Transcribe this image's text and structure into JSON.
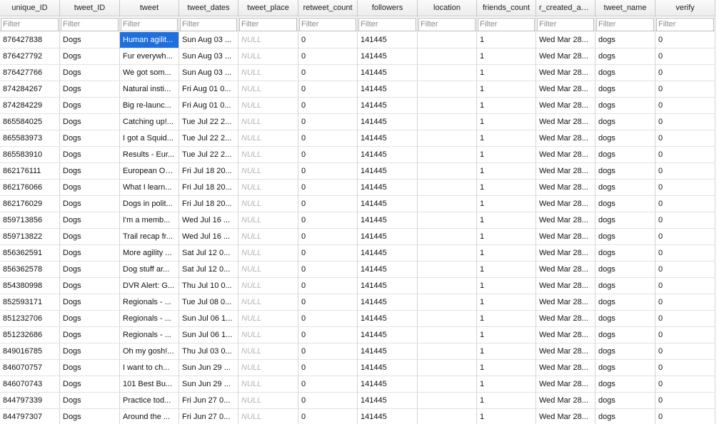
{
  "columns": [
    "unique_ID",
    "tweet_ID",
    "tweet",
    "tweet_dates",
    "tweet_place",
    "retweet_count",
    "followers",
    "location",
    "friends_count",
    "r_created_acco",
    "tweet_name",
    "verify"
  ],
  "filter_placeholder": "Filter",
  "null_text": "NULL",
  "selected": {
    "row": 0,
    "col": 2
  },
  "colors": {
    "selection": "#1f6fdc",
    "null_text": "#b3b3b3",
    "grid_line": "#d4d4d4"
  },
  "rows": [
    [
      "876427838",
      "Dogs",
      "Human agilit...",
      "Sun Aug 03 ...",
      "NULL",
      "0",
      "141445",
      "",
      "1",
      "Wed Mar 28...",
      "dogs",
      "0"
    ],
    [
      "876427792",
      "Dogs",
      "Fur everywh...",
      "Sun Aug 03 ...",
      "NULL",
      "0",
      "141445",
      "",
      "1",
      "Wed Mar 28...",
      "dogs",
      "0"
    ],
    [
      "876427766",
      "Dogs",
      "We got som...",
      "Sun Aug 03 ...",
      "NULL",
      "0",
      "141445",
      "",
      "1",
      "Wed Mar 28...",
      "dogs",
      "0"
    ],
    [
      "874284267",
      "Dogs",
      "Natural insti...",
      "Fri Aug 01 0...",
      "NULL",
      "0",
      "141445",
      "",
      "1",
      "Wed Mar 28...",
      "dogs",
      "0"
    ],
    [
      "874284229",
      "Dogs",
      "Big re-launc...",
      "Fri Aug 01 0...",
      "NULL",
      "0",
      "141445",
      "",
      "1",
      "Wed Mar 28...",
      "dogs",
      "0"
    ],
    [
      "865584025",
      "Dogs",
      "Catching up!...",
      "Tue Jul 22 2...",
      "NULL",
      "0",
      "141445",
      "",
      "1",
      "Wed Mar 28...",
      "dogs",
      "0"
    ],
    [
      "865583973",
      "Dogs",
      "I got a Squid...",
      "Tue Jul 22 2...",
      "NULL",
      "0",
      "141445",
      "",
      "1",
      "Wed Mar 28...",
      "dogs",
      "0"
    ],
    [
      "865583910",
      "Dogs",
      "Results - Eur...",
      "Tue Jul 22 2...",
      "NULL",
      "0",
      "141445",
      "",
      "1",
      "Wed Mar 28...",
      "dogs",
      "0"
    ],
    [
      "862176111",
      "Dogs",
      "European Op...",
      "Fri Jul 18 20...",
      "NULL",
      "0",
      "141445",
      "",
      "1",
      "Wed Mar 28...",
      "dogs",
      "0"
    ],
    [
      "862176066",
      "Dogs",
      "What I learn...",
      "Fri Jul 18 20...",
      "NULL",
      "0",
      "141445",
      "",
      "1",
      "Wed Mar 28...",
      "dogs",
      "0"
    ],
    [
      "862176029",
      "Dogs",
      "Dogs in polit...",
      "Fri Jul 18 20...",
      "NULL",
      "0",
      "141445",
      "",
      "1",
      "Wed Mar 28...",
      "dogs",
      "0"
    ],
    [
      "859713856",
      "Dogs",
      "I'm a memb...",
      "Wed Jul 16 ...",
      "NULL",
      "0",
      "141445",
      "",
      "1",
      "Wed Mar 28...",
      "dogs",
      "0"
    ],
    [
      "859713822",
      "Dogs",
      "Trail recap fr...",
      "Wed Jul 16 ...",
      "NULL",
      "0",
      "141445",
      "",
      "1",
      "Wed Mar 28...",
      "dogs",
      "0"
    ],
    [
      "856362591",
      "Dogs",
      "More agility ...",
      "Sat Jul 12 0...",
      "NULL",
      "0",
      "141445",
      "",
      "1",
      "Wed Mar 28...",
      "dogs",
      "0"
    ],
    [
      "856362578",
      "Dogs",
      "Dog stuff ar...",
      "Sat Jul 12 0...",
      "NULL",
      "0",
      "141445",
      "",
      "1",
      "Wed Mar 28...",
      "dogs",
      "0"
    ],
    [
      "854380998",
      "Dogs",
      "DVR Alert: G...",
      "Thu Jul 10 0...",
      "NULL",
      "0",
      "141445",
      "",
      "1",
      "Wed Mar 28...",
      "dogs",
      "0"
    ],
    [
      "852593171",
      "Dogs",
      "Regionals - ...",
      "Tue Jul 08 0...",
      "NULL",
      "0",
      "141445",
      "",
      "1",
      "Wed Mar 28...",
      "dogs",
      "0"
    ],
    [
      "851232706",
      "Dogs",
      "Regionals - ...",
      "Sun Jul 06 1...",
      "NULL",
      "0",
      "141445",
      "",
      "1",
      "Wed Mar 28...",
      "dogs",
      "0"
    ],
    [
      "851232686",
      "Dogs",
      "Regionals - ...",
      "Sun Jul 06 1...",
      "NULL",
      "0",
      "141445",
      "",
      "1",
      "Wed Mar 28...",
      "dogs",
      "0"
    ],
    [
      "849016785",
      "Dogs",
      "Oh my gosh!...",
      "Thu Jul 03 0...",
      "NULL",
      "0",
      "141445",
      "",
      "1",
      "Wed Mar 28...",
      "dogs",
      "0"
    ],
    [
      "846070757",
      "Dogs",
      "I want to ch...",
      "Sun Jun 29 ...",
      "NULL",
      "0",
      "141445",
      "",
      "1",
      "Wed Mar 28...",
      "dogs",
      "0"
    ],
    [
      "846070743",
      "Dogs",
      "101 Best Bu...",
      "Sun Jun 29 ...",
      "NULL",
      "0",
      "141445",
      "",
      "1",
      "Wed Mar 28...",
      "dogs",
      "0"
    ],
    [
      "844797339",
      "Dogs",
      "Practice tod...",
      "Fri Jun 27 0...",
      "NULL",
      "0",
      "141445",
      "",
      "1",
      "Wed Mar 28...",
      "dogs",
      "0"
    ],
    [
      "844797307",
      "Dogs",
      "Around the ...",
      "Fri Jun 27 0...",
      "NULL",
      "0",
      "141445",
      "",
      "1",
      "Wed Mar 28...",
      "dogs",
      "0"
    ]
  ]
}
